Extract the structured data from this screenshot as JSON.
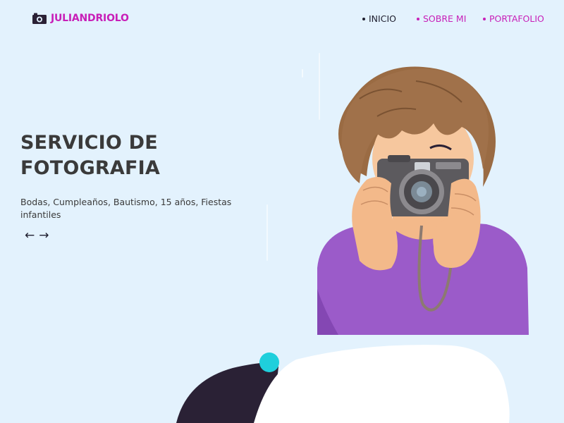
{
  "brand": {
    "name": "JULIANDRIOLO",
    "icon": "camera-icon",
    "color": "#c81fb8"
  },
  "nav": {
    "items": [
      {
        "label": "INICIO",
        "active": true
      },
      {
        "label": "SOBRE MI",
        "active": false
      },
      {
        "label": "PORTAFOLIO",
        "active": false
      }
    ]
  },
  "hero": {
    "title_line1": "SERVICIO DE",
    "title_line2": "FOTOGRAFIA",
    "subtitle": "Bodas, Cumpleaños, Bautismo, 15 años, Fiestas infantiles",
    "prev_arrow": "←",
    "next_arrow": "→"
  },
  "colors": {
    "background": "#e3f2fd",
    "accent_magenta": "#c81fb8",
    "dark_navy": "#2a2135",
    "cyan_dot": "#1fcfdc",
    "shirt_purple": "#9b5bc9"
  }
}
